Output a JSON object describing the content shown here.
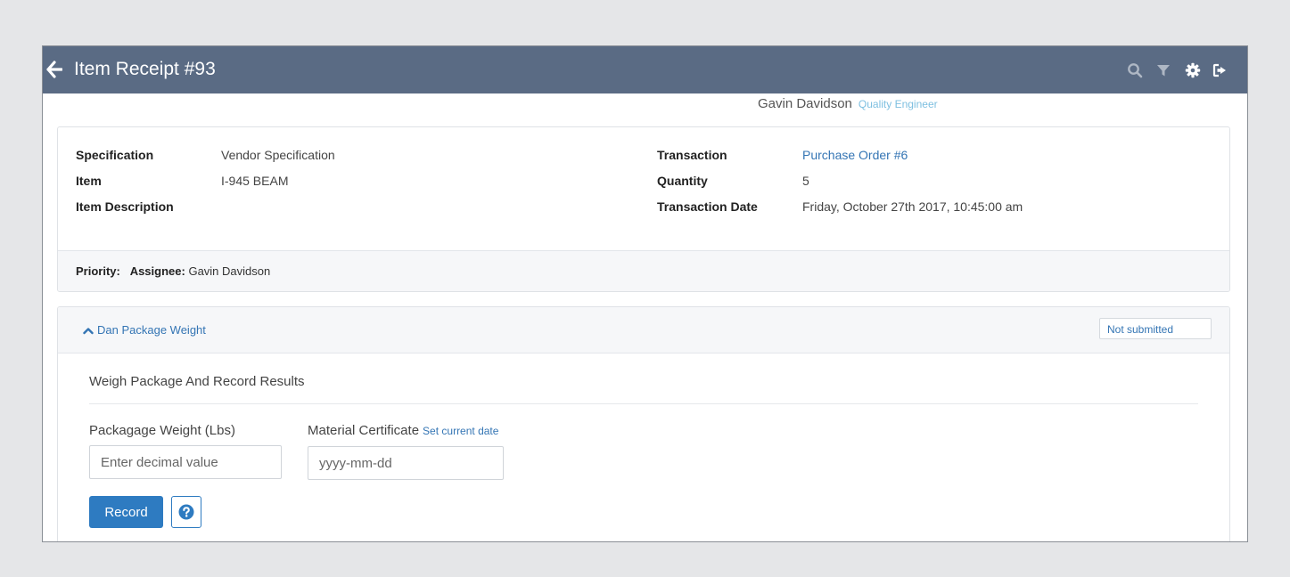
{
  "header": {
    "title": "Item Receipt #93",
    "icons": [
      "back-arrow-icon",
      "search-icon",
      "filter-icon",
      "gear-icon",
      "sign-out-icon"
    ],
    "bar_color": "#5a6b84"
  },
  "user": {
    "name": "Gavin Davidson",
    "role": "Quality Engineer"
  },
  "details": {
    "specification_label": "Specification",
    "specification_value": "Vendor Specification",
    "item_label": "Item",
    "item_value": "I-945 BEAM",
    "item_description_label": "Item Description",
    "transaction_label": "Transaction",
    "transaction_value": "Purchase Order #6",
    "quantity_label": "Quantity",
    "quantity_value": "5",
    "transaction_date_label": "Transaction Date",
    "transaction_date_value": "Friday, October 27th 2017, 10:45:00 am"
  },
  "footer": {
    "priority_label": "Priority:",
    "assignee_label": "Assignee:",
    "assignee_value": "Gavin Davidson"
  },
  "step": {
    "toggle_label": "Dan Package Weight",
    "status": "Not submitted",
    "title": "Weigh Package And Record Results",
    "weight_label": "Packagage Weight (Lbs)",
    "weight_placeholder": "Enter decimal value",
    "cert_label": "Material Certificate",
    "set_date_link": "Set current date",
    "cert_placeholder": "yyyy-mm-dd",
    "record_button": "Record"
  },
  "colors": {
    "accent": "#2e7bc1",
    "link": "#3475b4",
    "role": "#7dbfe0"
  }
}
